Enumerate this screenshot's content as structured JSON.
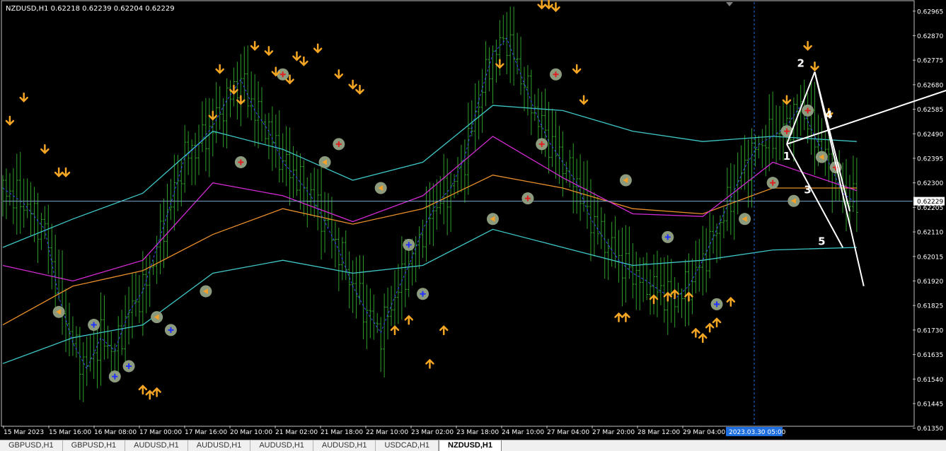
{
  "header": {
    "symbol_line": "NZDUSD,H1  0.62218 0.62239 0.62204 0.62229"
  },
  "colors": {
    "background": "#000000",
    "candle": "#2f9e2a",
    "axis": "#c0c0c0",
    "ma_magenta": "#d22ad2",
    "ma_orange": "#e98f2a",
    "band_cyan": "#3fc7c7",
    "dots_blue": "#3a4cff",
    "arrow_orange": "#f5a623",
    "price_line": "#7aa7c7",
    "time_marker": "#1f6fe0"
  },
  "chart_data": {
    "type": "candlestick",
    "symbol": "NZDUSD",
    "timeframe": "H1",
    "ohlc_header": {
      "open": 0.62218,
      "high": 0.62239,
      "low": 0.62204,
      "close": 0.62229
    },
    "ylim": [
      0.6136,
      0.63
    ],
    "y_ticks": [
      "0.62965",
      "0.62870",
      "0.62775",
      "0.62680",
      "0.62585",
      "0.62490",
      "0.62395",
      "0.62300",
      "0.62205",
      "0.62110",
      "0.62015",
      "0.61920",
      "0.61825",
      "0.61730",
      "0.61635",
      "0.61540",
      "0.61445",
      "0.61350"
    ],
    "current_price_label": "0.62229",
    "x_ticks": [
      "15 Mar 2023",
      "15 Mar 16:00",
      "16 Mar 08:00",
      "17 Mar 00:00",
      "17 Mar 16:00",
      "20 Mar 10:00",
      "21 Mar 02:00",
      "21 Mar 18:00",
      "22 Mar 10:00",
      "23 Mar 02:00",
      "23 Mar 18:00",
      "24 Mar 10:00",
      "27 Mar 04:00",
      "27 Mar 20:00",
      "28 Mar 12:00",
      "29 Mar 04:00"
    ],
    "time_marker_label": "2023.03.30 05:00",
    "close_path": [
      [
        0,
        0.6228
      ],
      [
        3,
        0.6222
      ],
      [
        6,
        0.6212
      ],
      [
        8,
        0.6186
      ],
      [
        10,
        0.6168
      ],
      [
        12,
        0.6158
      ],
      [
        14,
        0.617
      ],
      [
        16,
        0.6165
      ],
      [
        18,
        0.618
      ],
      [
        20,
        0.6188
      ],
      [
        22,
        0.6205
      ],
      [
        24,
        0.6222
      ],
      [
        26,
        0.624
      ],
      [
        28,
        0.6245
      ],
      [
        30,
        0.6252
      ],
      [
        32,
        0.6262
      ],
      [
        34,
        0.627
      ],
      [
        36,
        0.6258
      ],
      [
        38,
        0.625
      ],
      [
        40,
        0.6238
      ],
      [
        42,
        0.6232
      ],
      [
        44,
        0.6225
      ],
      [
        46,
        0.6215
      ],
      [
        48,
        0.6204
      ],
      [
        50,
        0.619
      ],
      [
        52,
        0.618
      ],
      [
        54,
        0.6172
      ],
      [
        56,
        0.6186
      ],
      [
        58,
        0.6198
      ],
      [
        60,
        0.6212
      ],
      [
        62,
        0.6222
      ],
      [
        64,
        0.6228
      ],
      [
        66,
        0.624
      ],
      [
        68,
        0.6262
      ],
      [
        70,
        0.628
      ],
      [
        72,
        0.6286
      ],
      [
        74,
        0.6272
      ],
      [
        76,
        0.6258
      ],
      [
        78,
        0.6246
      ],
      [
        80,
        0.6238
      ],
      [
        82,
        0.623
      ],
      [
        84,
        0.6216
      ],
      [
        86,
        0.6208
      ],
      [
        88,
        0.62
      ],
      [
        90,
        0.6195
      ],
      [
        92,
        0.6192
      ],
      [
        94,
        0.6188
      ],
      [
        96,
        0.6185
      ],
      [
        98,
        0.619
      ],
      [
        100,
        0.62
      ],
      [
        102,
        0.6212
      ],
      [
        104,
        0.6224
      ],
      [
        106,
        0.6236
      ],
      [
        108,
        0.6245
      ],
      [
        110,
        0.6248
      ],
      [
        112,
        0.6252
      ],
      [
        114,
        0.626
      ],
      [
        116,
        0.6248
      ],
      [
        118,
        0.6238
      ],
      [
        120,
        0.6226
      ],
      [
        122,
        0.6222
      ]
    ],
    "lines": {
      "ma_magenta": [
        [
          0,
          0.6198
        ],
        [
          10,
          0.6192
        ],
        [
          20,
          0.62
        ],
        [
          30,
          0.623
        ],
        [
          40,
          0.6225
        ],
        [
          50,
          0.6215
        ],
        [
          60,
          0.6225
        ],
        [
          70,
          0.6248
        ],
        [
          80,
          0.6232
        ],
        [
          90,
          0.6218
        ],
        [
          100,
          0.6217
        ],
        [
          110,
          0.6238
        ],
        [
          122,
          0.6227
        ]
      ],
      "ma_orange": [
        [
          0,
          0.6175
        ],
        [
          10,
          0.619
        ],
        [
          20,
          0.6196
        ],
        [
          30,
          0.621
        ],
        [
          40,
          0.622
        ],
        [
          50,
          0.6214
        ],
        [
          60,
          0.622
        ],
        [
          70,
          0.6233
        ],
        [
          80,
          0.6228
        ],
        [
          90,
          0.622
        ],
        [
          100,
          0.6218
        ],
        [
          110,
          0.6228
        ],
        [
          122,
          0.6228
        ]
      ],
      "band_upper": [
        [
          0,
          0.6205
        ],
        [
          10,
          0.6216
        ],
        [
          20,
          0.6226
        ],
        [
          30,
          0.625
        ],
        [
          40,
          0.6243
        ],
        [
          50,
          0.6231
        ],
        [
          60,
          0.6238
        ],
        [
          70,
          0.626
        ],
        [
          80,
          0.6258
        ],
        [
          90,
          0.625
        ],
        [
          100,
          0.6246
        ],
        [
          110,
          0.6248
        ],
        [
          122,
          0.6246
        ]
      ],
      "band_lower": [
        [
          0,
          0.616
        ],
        [
          10,
          0.617
        ],
        [
          20,
          0.6175
        ],
        [
          30,
          0.6195
        ],
        [
          40,
          0.62
        ],
        [
          50,
          0.6195
        ],
        [
          60,
          0.6198
        ],
        [
          70,
          0.6212
        ],
        [
          80,
          0.6205
        ],
        [
          90,
          0.6198
        ],
        [
          100,
          0.62
        ],
        [
          110,
          0.6204
        ],
        [
          122,
          0.6205
        ]
      ]
    },
    "signal_circles": [
      [
        8,
        0.618,
        "left"
      ],
      [
        13,
        0.6175,
        "down"
      ],
      [
        16,
        0.6155,
        "down"
      ],
      [
        18,
        0.6159,
        "down"
      ],
      [
        22,
        0.6178,
        "left"
      ],
      [
        24,
        0.6173,
        "down"
      ],
      [
        29,
        0.6188,
        "left"
      ],
      [
        34,
        0.6238,
        "up"
      ],
      [
        40,
        0.6272,
        "up"
      ],
      [
        46,
        0.6238,
        "left"
      ],
      [
        48,
        0.6245,
        "up"
      ],
      [
        54,
        0.6228,
        "left"
      ],
      [
        58,
        0.6206,
        "down"
      ],
      [
        60,
        0.6187,
        "down"
      ],
      [
        70,
        0.6216,
        "left"
      ],
      [
        75,
        0.6224,
        "up"
      ],
      [
        77,
        0.6245,
        "up"
      ],
      [
        79,
        0.6272,
        "up"
      ],
      [
        89,
        0.6231,
        "left"
      ],
      [
        95,
        0.6209,
        "down"
      ],
      [
        102,
        0.6183,
        "down"
      ],
      [
        106,
        0.6216,
        "left"
      ],
      [
        110,
        0.623,
        "up"
      ],
      [
        112,
        0.625,
        "up"
      ],
      [
        113,
        0.6223,
        "left"
      ],
      [
        115,
        0.6258,
        "up"
      ],
      [
        117,
        0.624,
        "left"
      ],
      [
        119,
        0.6236,
        "up"
      ]
    ],
    "down_arrows": [
      [
        1,
        0.6254
      ],
      [
        3,
        0.6263
      ],
      [
        6,
        0.6243
      ],
      [
        8,
        0.6234
      ],
      [
        9,
        0.6234
      ],
      [
        30,
        0.6256
      ],
      [
        31,
        0.6274
      ],
      [
        33,
        0.6266
      ],
      [
        34,
        0.6262
      ],
      [
        36,
        0.6283
      ],
      [
        38,
        0.6281
      ],
      [
        39,
        0.6273
      ],
      [
        41,
        0.627
      ],
      [
        42,
        0.6279
      ],
      [
        43,
        0.6277
      ],
      [
        45,
        0.6282
      ],
      [
        48,
        0.6272
      ],
      [
        50,
        0.6268
      ],
      [
        51,
        0.6266
      ],
      [
        71,
        0.6276
      ],
      [
        77,
        0.6299
      ],
      [
        78,
        0.6299
      ],
      [
        79,
        0.6298
      ],
      [
        82,
        0.6274
      ],
      [
        83,
        0.6262
      ],
      [
        112,
        0.6262
      ],
      [
        115,
        0.6283
      ],
      [
        116,
        0.6275
      ],
      [
        118,
        0.6257
      ]
    ],
    "up_arrows": [
      [
        20,
        0.615
      ],
      [
        21,
        0.6148
      ],
      [
        22,
        0.6149
      ],
      [
        56,
        0.6173
      ],
      [
        58,
        0.6177
      ],
      [
        61,
        0.616
      ],
      [
        63,
        0.6173
      ],
      [
        88,
        0.6178
      ],
      [
        89,
        0.6178
      ],
      [
        93,
        0.6185
      ],
      [
        95,
        0.6186
      ],
      [
        96,
        0.6187
      ],
      [
        98,
        0.6186
      ],
      [
        99,
        0.6172
      ],
      [
        100,
        0.617
      ],
      [
        101,
        0.6174
      ],
      [
        102,
        0.6176
      ],
      [
        104,
        0.6184
      ]
    ],
    "wave_labels": [
      {
        "text": "2",
        "bar": 114,
        "price": 0.6275
      },
      {
        "text": "4",
        "bar": 118,
        "price": 0.6255
      },
      {
        "text": "1",
        "bar": 112,
        "price": 0.6239
      },
      {
        "text": "3",
        "bar": 115,
        "price": 0.6226
      },
      {
        "text": "5",
        "bar": 117,
        "price": 0.6206
      }
    ],
    "trend_lines": [
      [
        [
          112,
          0.6245
        ],
        [
          116,
          0.6273
        ]
      ],
      [
        [
          116,
          0.6273
        ],
        [
          121,
          0.6219
        ]
      ],
      [
        [
          112,
          0.6245
        ],
        [
          135,
          0.6266
        ]
      ],
      [
        [
          112,
          0.6245
        ],
        [
          120,
          0.6205
        ]
      ],
      [
        [
          116,
          0.6273
        ],
        [
          123,
          0.619
        ]
      ]
    ]
  },
  "tabs": [
    "GBPUSD,H1",
    "GBPUSD,H1",
    "AUDUSD,H1",
    "AUDUSD,H1",
    "AUDUSD,H1",
    "AUDUSD,H1",
    "USDCAD,H1",
    "NZDUSD,H1"
  ],
  "active_tab": "NZDUSD,H1"
}
